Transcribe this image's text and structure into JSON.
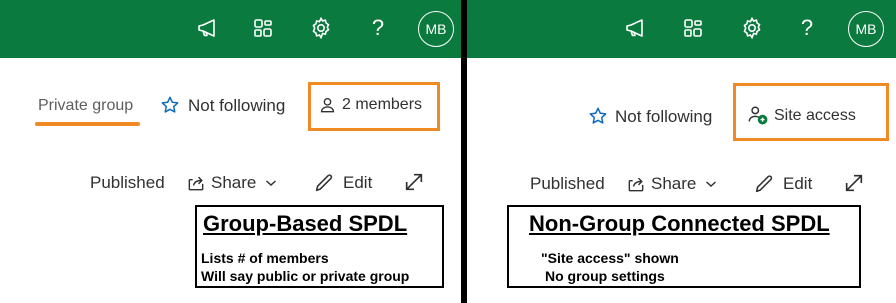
{
  "left_panel": {
    "avatar_initials": "MB",
    "help_glyph": "?",
    "group_type": "Private group",
    "follow_label": "Not following",
    "members_label": "2 members",
    "toolbar": {
      "published": "Published",
      "share": "Share",
      "edit": "Edit"
    },
    "annotation": {
      "title": "Group-Based SPDL",
      "lines": [
        "Lists # of members",
        "Will say public or private group"
      ]
    }
  },
  "right_panel": {
    "avatar_initials": "MB",
    "help_glyph": "?",
    "follow_label": "Not following",
    "site_access_label": "Site access",
    "toolbar": {
      "published": "Published",
      "share": "Share",
      "edit": "Edit"
    },
    "annotation": {
      "title": "Non-Group Connected SPDL",
      "lines": [
        "\"Site access\" shown",
        "No group settings"
      ]
    }
  },
  "colors": {
    "suite_bar": "#0b7a3e",
    "highlight": "#f08a24",
    "follow_star": "#0f6cbd",
    "site_access_icon": "#0b7a3e"
  },
  "icons": [
    "megaphone-icon",
    "apps-feed-icon",
    "gear-icon",
    "help-icon",
    "star-icon",
    "person-icon",
    "person-add-icon",
    "share-icon",
    "chevron-down-icon",
    "pencil-icon",
    "expand-icon"
  ]
}
